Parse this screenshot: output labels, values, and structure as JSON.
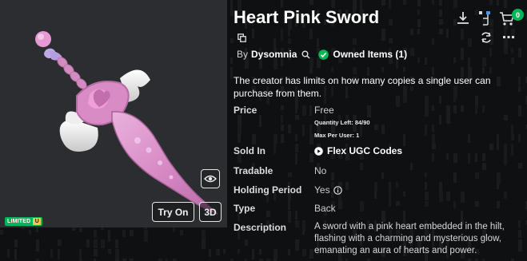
{
  "item": {
    "title": "Heart Pink Sword",
    "by_label": "By",
    "creator": "Dysomnia",
    "owned_label": "Owned Items (1)",
    "notice": "The creator has limits on how many copies a single user can purchase from them."
  },
  "viewer": {
    "try_on_label": "Try On",
    "view_3d_label": "3D",
    "limited_label": "LIMITED",
    "limited_suffix": "U"
  },
  "header": {
    "cart_count": "0"
  },
  "details": {
    "price_label": "Price",
    "price_value": "Free",
    "quantity_left": "Quantity Left: 84/90",
    "max_per_user": "Max Per User: 1",
    "sold_in_label": "Sold In",
    "sold_in_value": "Flex UGC Codes",
    "tradable_label": "Tradable",
    "tradable_value": "No",
    "holding_label": "Holding Period",
    "holding_value": "Yes",
    "type_label": "Type",
    "type_value": "Back",
    "description_label": "Description",
    "description_value": "A sword with a pink heart embedded in the hilt, flashing with a charming and mysterious glow, emanating an aura of hearts and power."
  },
  "icons": {
    "download": "download-icon",
    "tree": "hierarchy-icon",
    "cart": "cart-icon",
    "refresh": "refresh-icon",
    "more": "more-icon",
    "copy": "copy-icon",
    "search": "search-icon",
    "owned": "checkmark-icon",
    "play": "play-icon",
    "info": "info-icon",
    "eye": "eye-icon"
  },
  "colors": {
    "background": "#0f1011",
    "viewer_bg": "#2b2d30",
    "accent_green": "#02b757",
    "limited_badge": "#01b45a",
    "limited_u": "#f6c844",
    "sword_pink": "#d98bc6"
  }
}
